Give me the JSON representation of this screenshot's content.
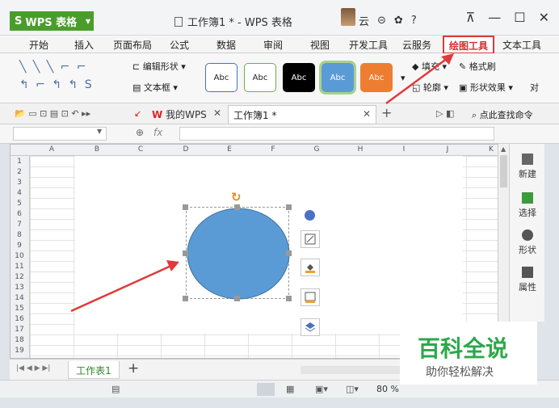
{
  "app": {
    "name": "WPS 表格",
    "window_title": "工作簿1 * - WPS 表格"
  },
  "title_controls": [
    "云",
    "⊝",
    "✿",
    "?"
  ],
  "menu_tabs": [
    "开始",
    "插入",
    "页面布局",
    "公式",
    "数据",
    "审阅",
    "视图",
    "开发工具",
    "云服务",
    "绘图工具",
    "文本工具"
  ],
  "active_tab": "绘图工具",
  "ribbon": {
    "edit_shape": "编辑形状",
    "text_box": "文本框",
    "style_label": "Abc",
    "fill": "填充",
    "outline": "轮廓",
    "format_brush": "格式刷",
    "shape_effects": "形状效果",
    "align": "对"
  },
  "doc_tabs": [
    "我的WPS",
    "工作簿1 *"
  ],
  "quick_search": "点此查找命令",
  "formula_bar": {
    "fx": "fx",
    "cell_ref": ""
  },
  "columns": [
    "A",
    "B",
    "C",
    "D",
    "E",
    "F",
    "G",
    "H",
    "I",
    "J",
    "K"
  ],
  "rows": [
    "1",
    "2",
    "3",
    "4",
    "5",
    "6",
    "7",
    "8",
    "9",
    "10",
    "11",
    "12",
    "13",
    "14",
    "15",
    "16",
    "17",
    "18",
    "19"
  ],
  "sheet_tab": "工作表1",
  "add_sheet": "+",
  "zoom": "80 %",
  "right_panel": [
    "新建",
    "选择",
    "形状",
    "属性"
  ],
  "watermark": {
    "title": "百科全说",
    "subtitle": "助你轻松解决"
  },
  "colors": {
    "accent_green": "#4a9d2c",
    "highlight_red": "#d93b3b",
    "shape_fill": "#5b9bd5"
  }
}
